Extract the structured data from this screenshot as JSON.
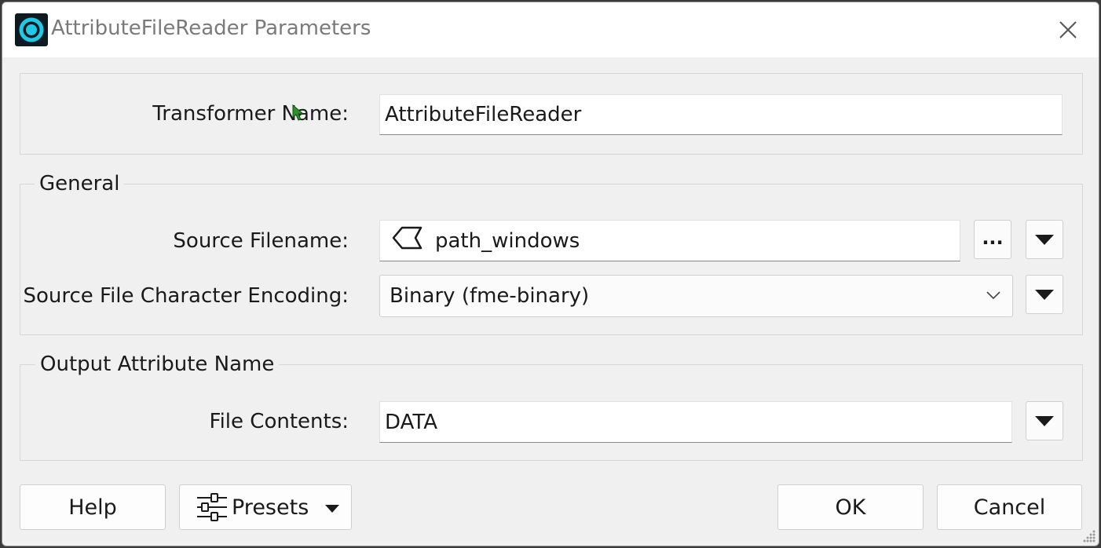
{
  "window": {
    "title": "AttributeFileReader Parameters"
  },
  "transformer": {
    "label": "Transformer Name:",
    "value": "AttributeFileReader"
  },
  "general": {
    "title": "General",
    "source_filename_label": "Source Filename:",
    "source_filename_value": "path_windows",
    "browse_label": "...",
    "encoding_label": "Source File Character Encoding:",
    "encoding_value": "Binary (fme-binary)"
  },
  "output": {
    "title": "Output Attribute Name",
    "file_contents_label": "File Contents:",
    "file_contents_value": "DATA"
  },
  "footer": {
    "help_label": "Help",
    "presets_label": "Presets",
    "ok_label": "OK",
    "cancel_label": "Cancel"
  },
  "icons": [
    "app-icon",
    "close-icon",
    "attribute-icon",
    "chevron-down-icon",
    "triangle-down-icon",
    "sliders-icon",
    "resize-grip-icon"
  ],
  "colors": {
    "window_bg": "#f0f0f0",
    "titlebar_bg": "#ffffff",
    "app_icon_ring": "#1ec8e6",
    "title_text": "#7a7a7a",
    "field_bg": "#ffffff"
  }
}
